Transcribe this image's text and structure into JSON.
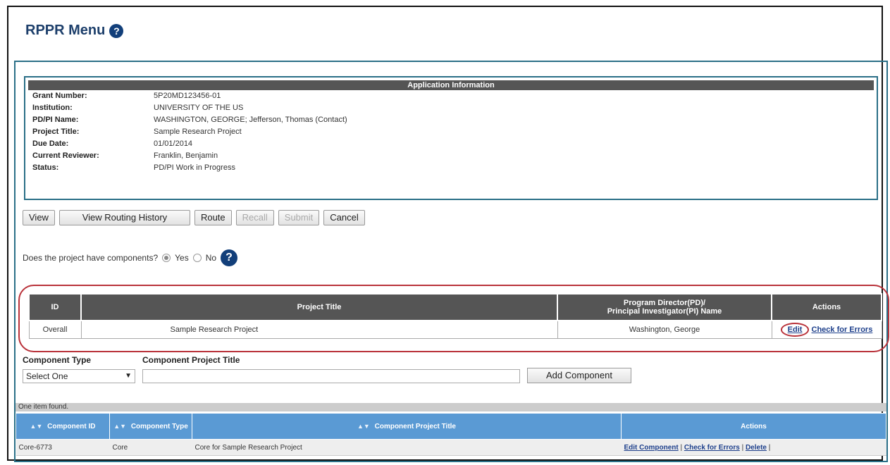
{
  "page": {
    "title": "RPPR Menu",
    "help_glyph": "?"
  },
  "app_info": {
    "header": "Application Information",
    "rows": [
      {
        "label": "Grant Number:",
        "value": "5P20MD123456-01"
      },
      {
        "label": "Institution:",
        "value": "UNIVERSITY OF THE US"
      },
      {
        "label": "PD/PI Name:",
        "value": "WASHINGTON, GEORGE; Jefferson, Thomas (Contact)"
      },
      {
        "label": "Project Title:",
        "value": "Sample Research Project"
      },
      {
        "label": "Due Date:",
        "value": "01/01/2014"
      },
      {
        "label": "Current Reviewer:",
        "value": "Franklin, Benjamin"
      },
      {
        "label": "Status:",
        "value": "PD/PI Work in Progress"
      }
    ]
  },
  "buttons": {
    "view": "View",
    "view_routing_history": "View Routing History",
    "route": "Route",
    "recall": "Recall",
    "submit": "Submit",
    "cancel": "Cancel"
  },
  "components_question": {
    "text": "Does the project have components?",
    "yes": "Yes",
    "no": "No",
    "selected": "Yes"
  },
  "project_table": {
    "headers": [
      "ID",
      "Project Title",
      "Program Director(PD)/",
      "Principal Investigator(PI) Name",
      "Actions"
    ],
    "row": {
      "id": "Overall",
      "title": "Sample Research Project",
      "pi": "Washington, George",
      "edit": "Edit",
      "check": "Check for Errors"
    }
  },
  "component_form": {
    "type_label": "Component Type",
    "title_label": "Component Project Title",
    "select_value": "Select One",
    "add_button": "Add Component"
  },
  "found_text": "One item found.",
  "component_table": {
    "headers": [
      "Component ID",
      "Component Type",
      "Component Project Title",
      "Actions"
    ],
    "row": {
      "id": "Core-6773",
      "type": "Core",
      "title": "Core for Sample Research Project",
      "edit": "Edit Component",
      "sep1": " | ",
      "check": "Check for Errors",
      "sep2": " | ",
      "delete": "Delete",
      "sep3": " |"
    }
  },
  "colors": {
    "title": "#1d3f6b",
    "panel_border": "#2a6f87",
    "highlight": "#b9323a",
    "table_header": "#5a9ad4"
  }
}
